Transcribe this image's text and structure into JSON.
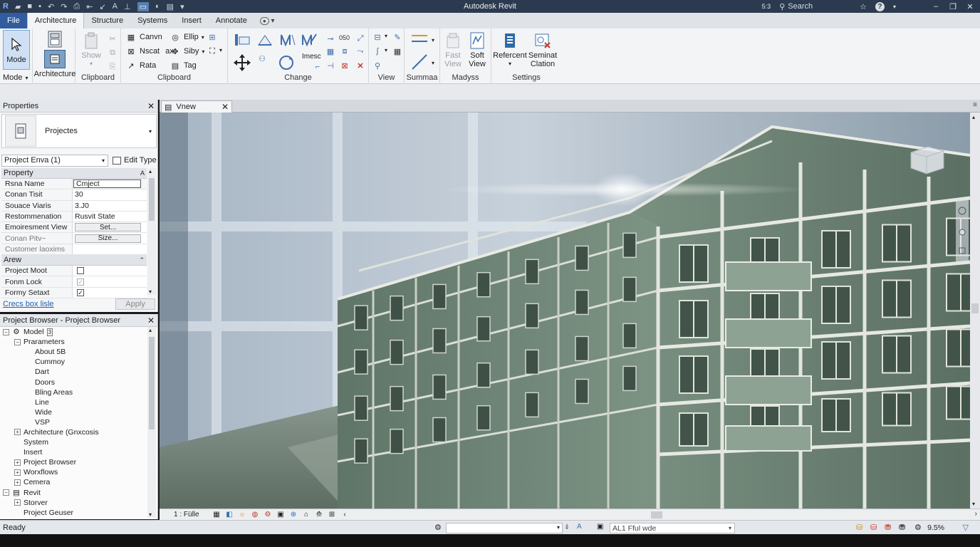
{
  "titlebar": {
    "app_title": "Autodesk Revit",
    "search_label": "Search",
    "account_label": "5:3",
    "help_label": "?"
  },
  "menu": {
    "tabs": [
      "File",
      "Architecture",
      "Structure",
      "Systems",
      "Insert",
      "Annotate"
    ],
    "active": "Architecture"
  },
  "ribbon": {
    "mode": {
      "button": "Mode",
      "panel": "Mode"
    },
    "architecture": {
      "button": "Architecture"
    },
    "clipboard": {
      "show": "Show",
      "panel": "Clipboard"
    },
    "clipboard2": {
      "canvn": "Canvn",
      "ellip": "Ellip",
      "nscat": "Nscat",
      "ax": "ax",
      "siby": "Siby",
      "rata": "Rata",
      "tag": "Tag",
      "panel": "Clipboard"
    },
    "change": {
      "imesc": "Imesc",
      "panel": "Change"
    },
    "view": {
      "panel": "View"
    },
    "summaa": {
      "panel": "Summaa"
    },
    "madyss": {
      "fast_view": "Fast\nView",
      "soft_view": "Soft\nView",
      "panel": "Madyss"
    },
    "settings": {
      "referent": "Refercent",
      "seminat": "Seminat\nClation",
      "panel": "Settings"
    }
  },
  "properties": {
    "title": "Properties",
    "type_name": "Projectes",
    "instance": "Project Enva (1)",
    "edit_type": "Edit Type",
    "group1": "Property",
    "group1_marker": "A",
    "rows": [
      {
        "k": "Rsna Name",
        "v": "Cmject"
      },
      {
        "k": "Conan Tisit",
        "v": "30"
      },
      {
        "k": "Souace Viaris",
        "v": "3.J0"
      },
      {
        "k": "Restommenation",
        "v": "Rusvit State"
      },
      {
        "k": "Emoiresment View",
        "v": "Set..."
      },
      {
        "k": "Conan Pitv~",
        "v": "Size..."
      },
      {
        "k": "Customer laoxims",
        "v": ""
      }
    ],
    "group2": "Arew",
    "rows2": [
      {
        "k": "Project Moot"
      },
      {
        "k": "Fonm Lock"
      },
      {
        "k": "Formy Setaxt"
      }
    ],
    "help_link": "Crecs box lisle",
    "apply": "Apply"
  },
  "browser": {
    "title": "Project Browser - Project Browser",
    "nodes": [
      {
        "label": "Model",
        "badge": "3",
        "level": 0,
        "exp": "−",
        "icon": "model"
      },
      {
        "label": "Prarameters",
        "level": 1,
        "exp": "−"
      },
      {
        "label": "About 5B",
        "level": 2
      },
      {
        "label": "Cummoy",
        "level": 2
      },
      {
        "label": "Dart",
        "level": 2
      },
      {
        "label": "Doors",
        "level": 2
      },
      {
        "label": "Bling Areas",
        "level": 2
      },
      {
        "label": "Line",
        "level": 2
      },
      {
        "label": "Wide",
        "level": 2
      },
      {
        "label": "VSP",
        "level": 2
      },
      {
        "label": "Architecture (Gnxcosis",
        "level": 1,
        "exp": "+"
      },
      {
        "label": "System",
        "level": 1
      },
      {
        "label": "Insert",
        "level": 1
      },
      {
        "label": "Project Browser",
        "level": 1,
        "exp": "+"
      },
      {
        "label": "Worxflows",
        "level": 1,
        "exp": "+"
      },
      {
        "label": "Cemera",
        "level": 1,
        "exp": "+"
      },
      {
        "label": "Revit",
        "level": 0,
        "exp": "−",
        "icon": "revit"
      },
      {
        "label": "Storver",
        "level": 1,
        "exp": "+"
      },
      {
        "label": "Project Geuser",
        "level": 1
      }
    ]
  },
  "view": {
    "tab": "Vnew",
    "scale": "1 : Fülle"
  },
  "status": {
    "ready": "Ready",
    "filter": "AL1 Fful wde",
    "zoom": "9.5%"
  },
  "colors": {
    "titlebar": "#2b3a4f",
    "file_tab": "#2f5d9e",
    "building_wall": "#6f8679",
    "building_trim": "#e6e8e2"
  }
}
